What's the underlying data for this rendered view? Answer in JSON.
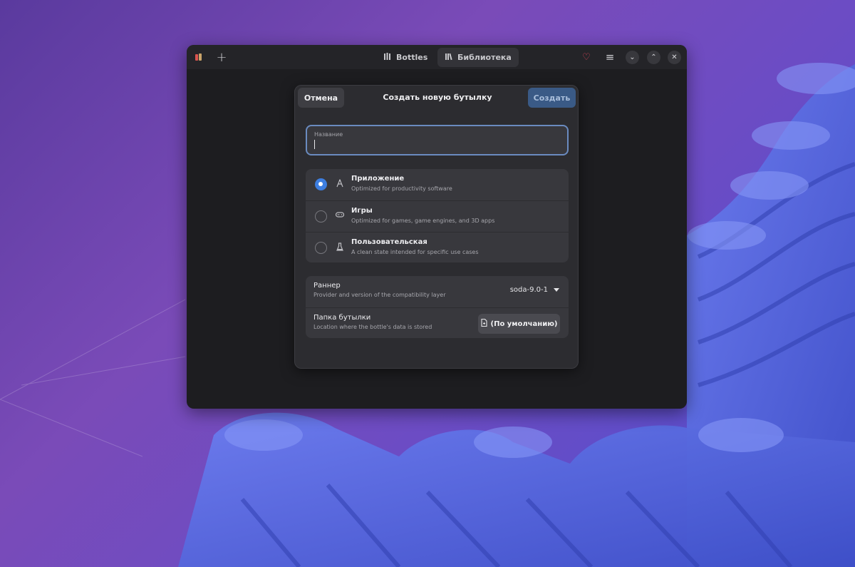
{
  "colors": {
    "accent": "#3d7ee0",
    "create_button_bg": "#3a5a86",
    "heart": "#e0455a",
    "window_bg": "#1d1d20",
    "dialog_bg": "#2c2c30"
  },
  "headerbar": {
    "tabs": [
      {
        "label": "Bottles",
        "icon": "bottles-icon"
      },
      {
        "label": "Библиотека",
        "icon": "library-icon"
      }
    ],
    "add_symbol": "+",
    "heart_symbol": "♡",
    "menu_symbol": "≡",
    "minimize_symbol": "⌄",
    "maximize_symbol": "⌃",
    "close_symbol": "✕"
  },
  "dialog": {
    "cancel_label": "Отмена",
    "title": "Создать новую бутылку",
    "create_label": "Создать",
    "name_field": {
      "label": "Название",
      "value": ""
    },
    "environments": [
      {
        "title": "Приложение",
        "subtitle": "Optimized for productivity software",
        "icon": "application-icon",
        "selected": true
      },
      {
        "title": "Игры",
        "subtitle": "Optimized for games, game engines, and 3D apps",
        "icon": "gamepad-icon",
        "selected": false
      },
      {
        "title": "Пользовательская",
        "subtitle": "A clean state intended for specific use cases",
        "icon": "flask-icon",
        "selected": false
      }
    ],
    "runner": {
      "title": "Раннер",
      "subtitle": "Provider and version of the compatibility layer",
      "value": "soda-9.0-1"
    },
    "folder": {
      "title": "Папка бутылки",
      "subtitle": "Location where the bottle's data is stored",
      "button_label": "(По умолчанию)"
    }
  }
}
